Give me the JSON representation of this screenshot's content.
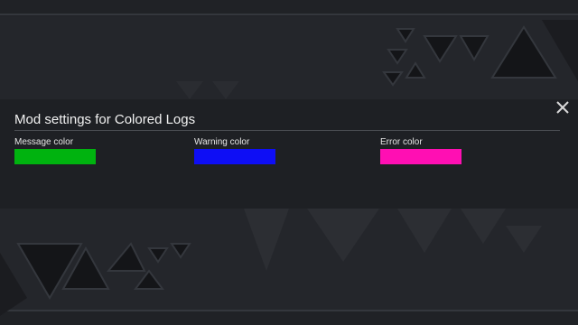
{
  "window": {
    "title": "Mod settings for Colored Logs",
    "close_icon": "close-icon"
  },
  "settings": [
    {
      "label": "Message color",
      "color": "#00b30f"
    },
    {
      "label": "Warning color",
      "color": "#0e0ef5"
    },
    {
      "label": "Error color",
      "color": "#ff0fb3"
    }
  ]
}
